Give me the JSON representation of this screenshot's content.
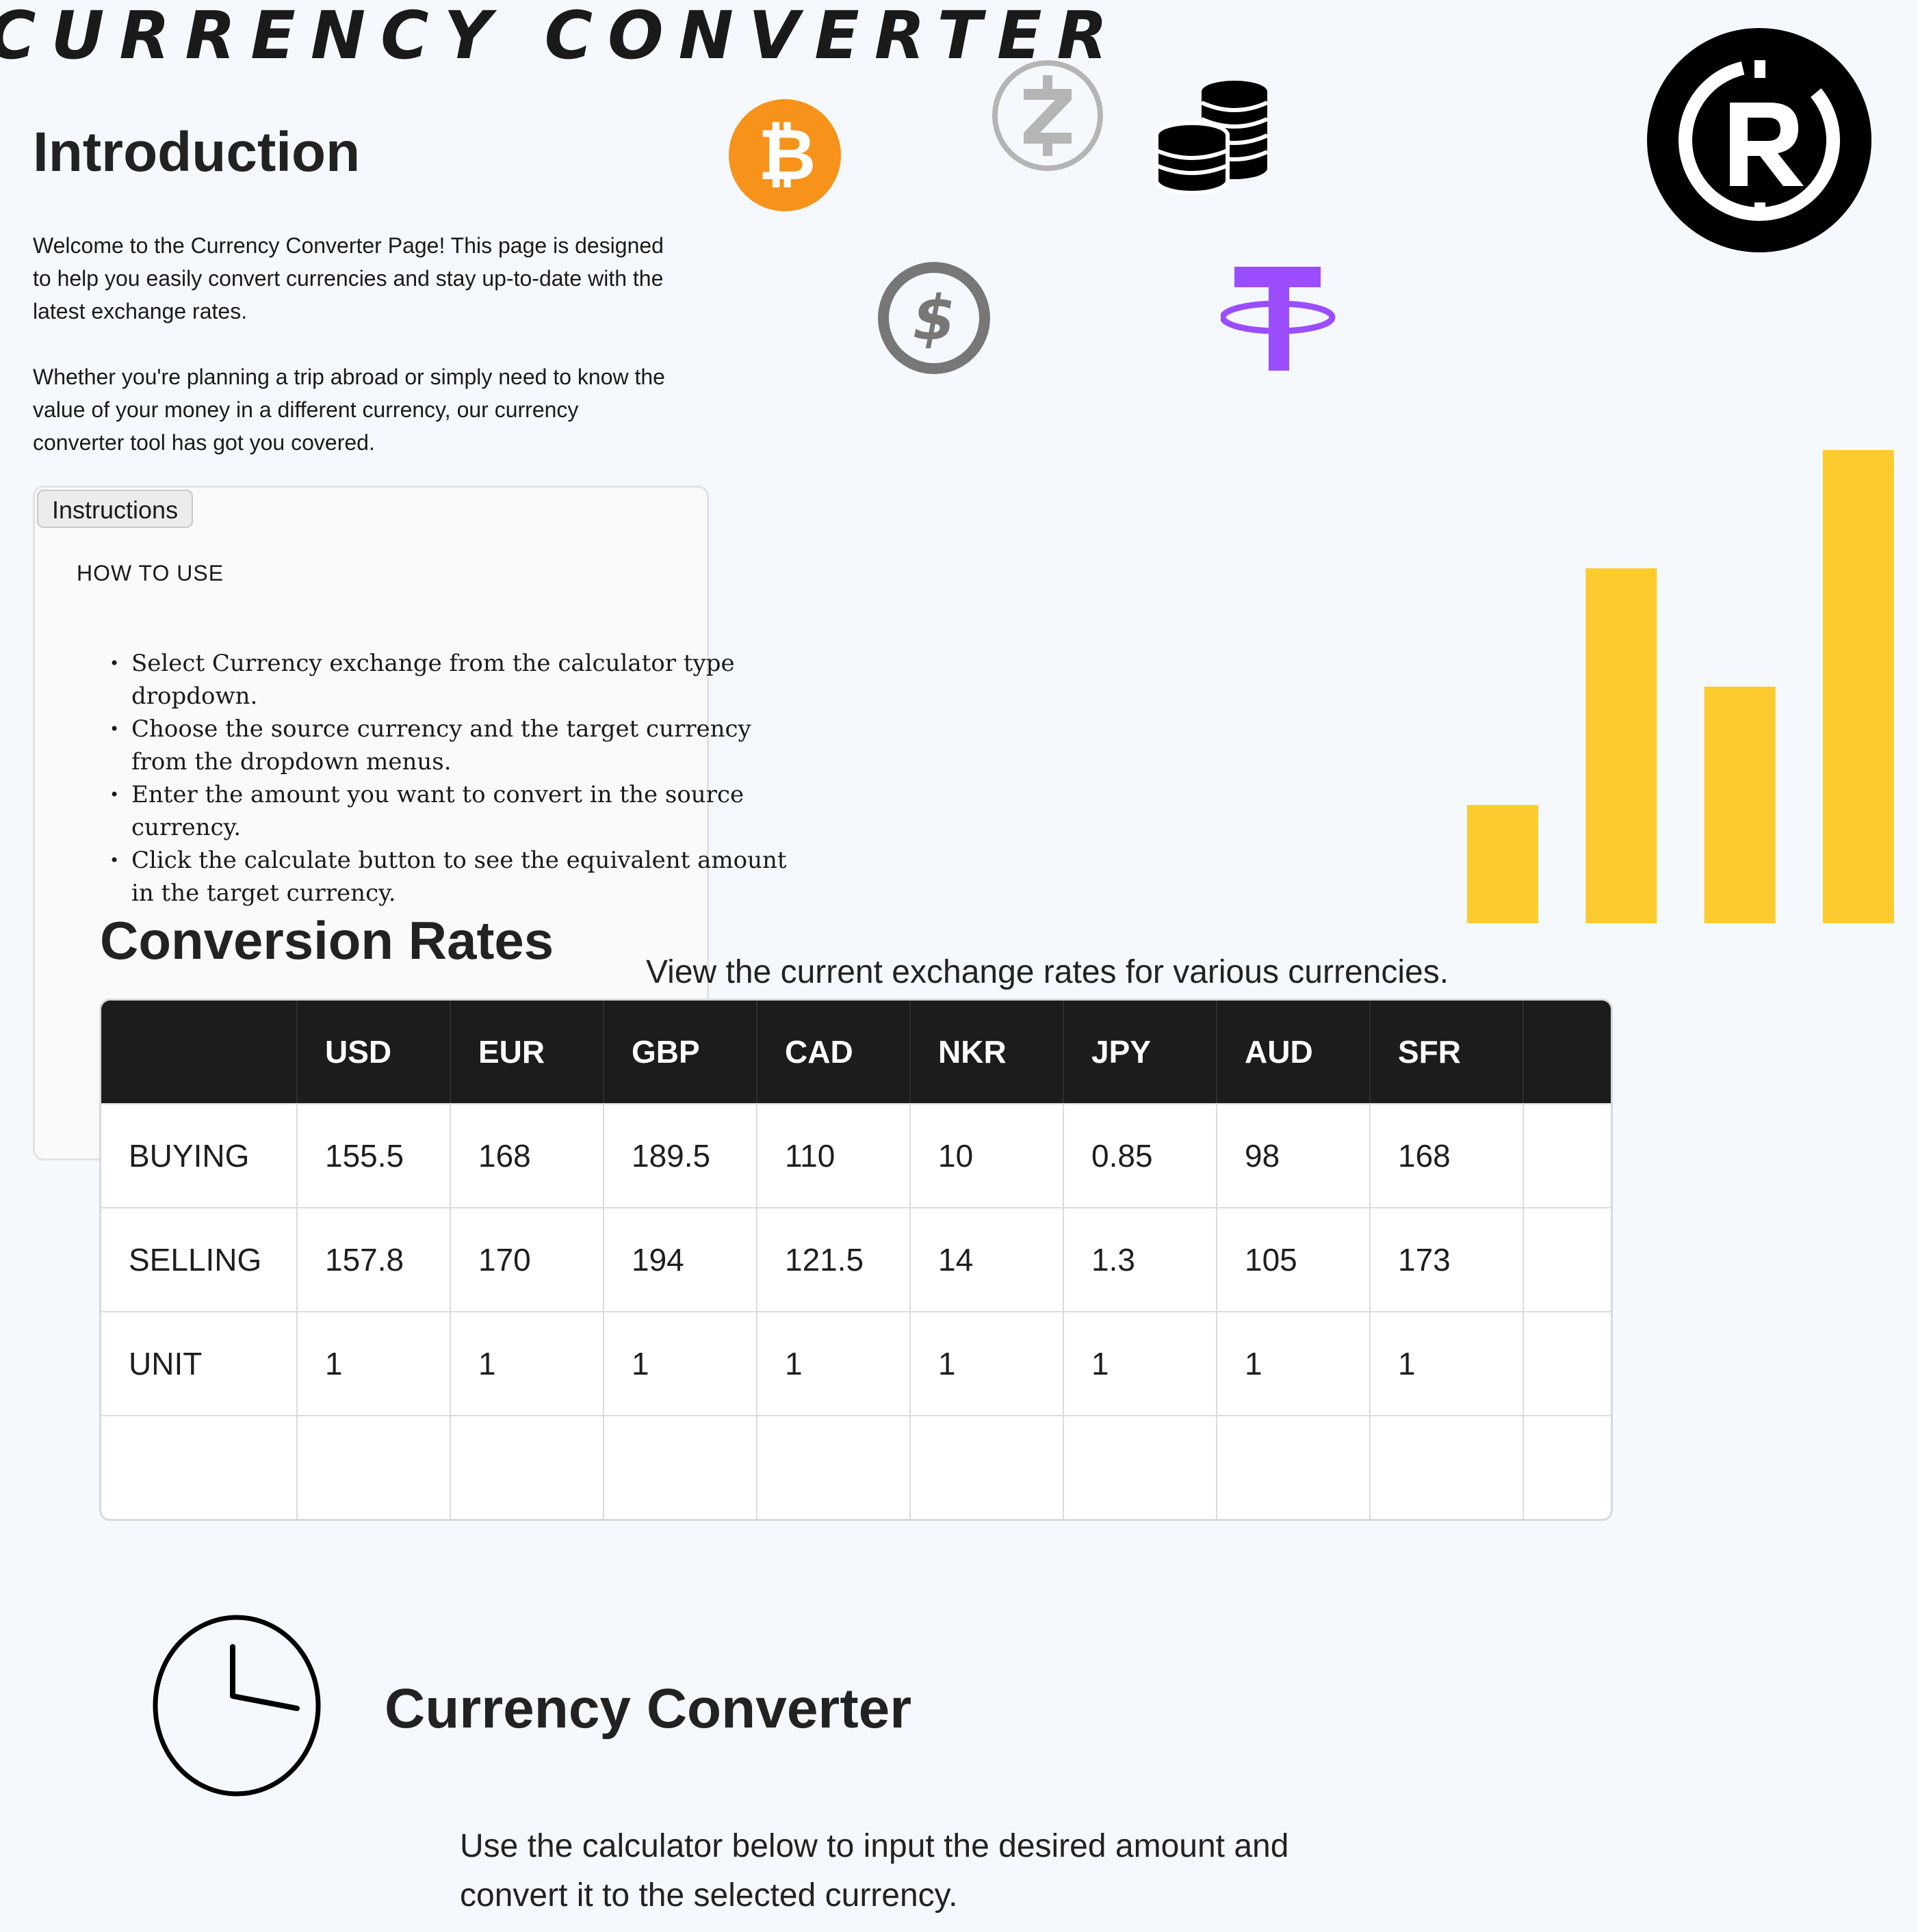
{
  "page": {
    "title": "CURRENCY CONVERTER"
  },
  "intro": {
    "heading": "Introduction",
    "paragraph1": "Welcome to the Currency Converter Page! This page is designed to help you easily convert currencies and stay up-to-date with the latest exchange rates.",
    "paragraph2": "Whether you're planning a trip abroad or simply need to know the value of your money in a different currency, our currency converter tool has got you covered."
  },
  "instructions": {
    "tab_label": "Instructions",
    "heading": "HOW TO USE",
    "steps": [
      "Select Currency exchange from the calculator type dropdown.",
      "Choose the source currency and the target currency from the dropdown menus.",
      "Enter the amount you want to convert in the source currency.",
      "Click the calculate button to see the equivalent amount in the target currency."
    ]
  },
  "icons": {
    "bitcoin": {
      "name": "bitcoin-icon",
      "color": "#f7931a"
    },
    "zcash": {
      "name": "zcash-icon",
      "color": "#b5b5b5"
    },
    "coin_stack": {
      "name": "coin-stack-icon",
      "color": "#000000"
    },
    "brand_logo": {
      "name": "rc-logo-icon",
      "color": "#000000"
    },
    "dollar": {
      "name": "dollar-coin-icon",
      "color": "#777777"
    },
    "tether": {
      "name": "tether-icon",
      "color": "#9b4dff"
    },
    "clock": {
      "name": "clock-icon",
      "color": "#000000"
    }
  },
  "chart_data": {
    "type": "bar",
    "values": [
      1,
      3,
      2,
      4
    ],
    "ylim": [
      0,
      4
    ],
    "color": "#fdcb2e"
  },
  "rates": {
    "heading": "Conversion Rates",
    "subtitle": "View the current exchange rates for various currencies.",
    "columns": [
      "",
      "USD",
      "EUR",
      "GBP",
      "CAD",
      "NKR",
      "JPY",
      "AUD",
      "SFR",
      ""
    ],
    "rows": [
      [
        "BUYING",
        "155.5",
        "168",
        "189.5",
        "110",
        "10",
        "0.85",
        "98",
        "168",
        ""
      ],
      [
        "SELLING",
        "157.8",
        "170",
        "194",
        "121.5",
        "14",
        "1.3",
        "105",
        "173",
        ""
      ],
      [
        "UNIT",
        "1",
        "1",
        "1",
        "1",
        "1",
        "1",
        "1",
        "1",
        ""
      ],
      [
        "",
        "",
        "",
        "",
        "",
        "",
        "",
        "",
        "",
        ""
      ]
    ]
  },
  "converter": {
    "heading": "Currency Converter",
    "description": "Use the calculator below to input the desired amount and convert it to the selected currency."
  }
}
